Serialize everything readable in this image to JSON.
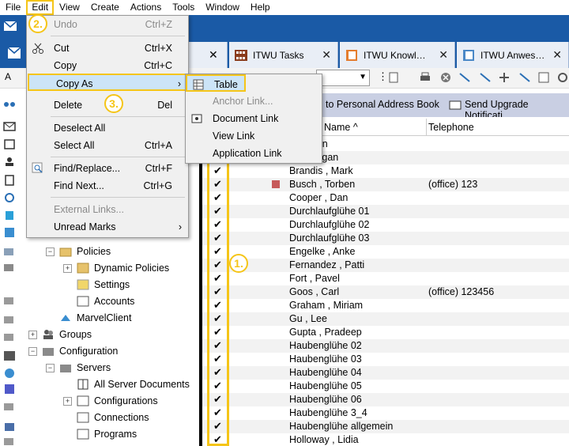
{
  "menubar": [
    "File",
    "Edit",
    "View",
    "Create",
    "Actions",
    "Tools",
    "Window",
    "Help"
  ],
  "tabs": [
    {
      "label": "ITWU Tasks",
      "icon": "film-icon"
    },
    {
      "label": "ITWU Knowl…",
      "icon": "database-icon"
    },
    {
      "label": "ITWU Anwes…",
      "icon": "database-icon"
    }
  ],
  "actions": {
    "personal": "to Personal Address Book",
    "upgrade": "Send Upgrade Notificati"
  },
  "edit_menu": {
    "undo": {
      "label": "Undo",
      "shortcut": "Ctrl+Z"
    },
    "cut": {
      "label": "Cut",
      "shortcut": "Ctrl+X"
    },
    "copy": {
      "label": "Copy",
      "shortcut": "Ctrl+C"
    },
    "copy_as": {
      "label": "Copy As"
    },
    "delete": {
      "label": "Delete",
      "shortcut": "Del"
    },
    "deselect_all": {
      "label": "Deselect All"
    },
    "select_all": {
      "label": "Select All",
      "shortcut": "Ctrl+A"
    },
    "find_replace": {
      "label": "Find/Replace...",
      "shortcut": "Ctrl+F"
    },
    "find_next": {
      "label": "Find Next...",
      "shortcut": "Ctrl+G"
    },
    "external_links": {
      "label": "External Links..."
    },
    "unread_marks": {
      "label": "Unread Marks"
    }
  },
  "copy_as_menu": {
    "table": "Table",
    "anchor_link": "Anchor Link...",
    "document_link": "Document Link",
    "view_link": "View Link",
    "application_link": "Application Link"
  },
  "badges": {
    "one": "1.",
    "two": "2.",
    "three": "3."
  },
  "tree": {
    "policies": "Policies",
    "dynamic_policies": "Dynamic Policies",
    "settings": "Settings",
    "accounts": "Accounts",
    "marvelclient": "MarvelClient",
    "groups": "Groups",
    "configuration": "Configuration",
    "servers": "Servers",
    "all_server_documents": "All Server Documents",
    "configurations": "Configurations",
    "connections": "Connections",
    "programs": "Programs"
  },
  "columns": {
    "name": "Name",
    "telephone": "Telephone"
  },
  "rows": [
    {
      "name": "ein",
      "tel": ""
    },
    {
      "name": "Megan",
      "tel": ""
    },
    {
      "name": "Brandis , Mark",
      "tel": ""
    },
    {
      "name": "Busch , Torben",
      "tel": "(office)  123"
    },
    {
      "name": "Cooper , Dan",
      "tel": ""
    },
    {
      "name": "Durchlaufglühe 01",
      "tel": ""
    },
    {
      "name": "Durchlaufglühe 02",
      "tel": ""
    },
    {
      "name": "Durchlaufglühe 03",
      "tel": ""
    },
    {
      "name": "Engelke , Anke",
      "tel": ""
    },
    {
      "name": "Fernandez , Patti",
      "tel": ""
    },
    {
      "name": "Fort , Pavel",
      "tel": ""
    },
    {
      "name": "Goos , Carl",
      "tel": "(office)  123456"
    },
    {
      "name": "Graham , Miriam",
      "tel": ""
    },
    {
      "name": "Gu , Lee",
      "tel": ""
    },
    {
      "name": "Gupta , Pradeep",
      "tel": ""
    },
    {
      "name": "Haubenglühe 02",
      "tel": ""
    },
    {
      "name": "Haubenglühe 03",
      "tel": ""
    },
    {
      "name": "Haubenglühe 04",
      "tel": ""
    },
    {
      "name": "Haubenglühe 05",
      "tel": ""
    },
    {
      "name": "Haubenglühe 06",
      "tel": ""
    },
    {
      "name": "Haubenglühe 3_4",
      "tel": ""
    },
    {
      "name": "Haubenglühe allgemein",
      "tel": ""
    },
    {
      "name": "Holloway , Lidia",
      "tel": ""
    }
  ],
  "check_glyph": "✔",
  "colors": {
    "accent_blue": "#1a5aa6",
    "highlight_yellow": "#f5c518",
    "selection_blue": "#cce4f7"
  }
}
